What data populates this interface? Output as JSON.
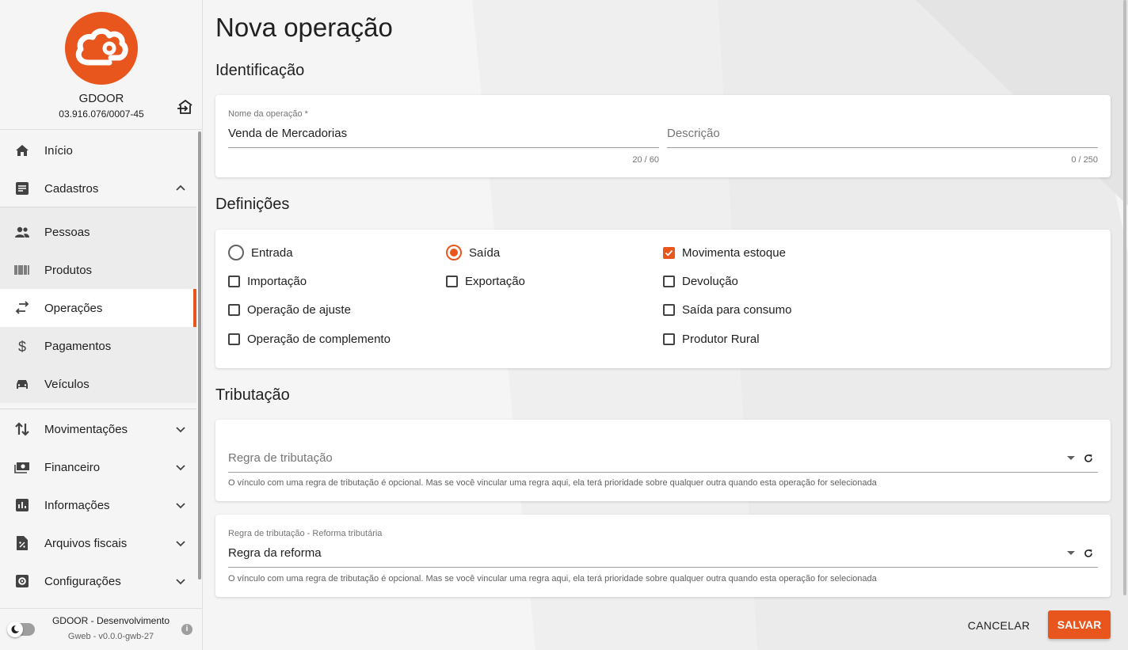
{
  "company": {
    "name": "GDOOR",
    "cnpj": "03.916.076/0007-45",
    "logo_icon": "gdoor-cloud-logo",
    "logout_icon": "logout-icon"
  },
  "nav": {
    "inicio": "Início",
    "cadastros": "Cadastros",
    "pessoas": "Pessoas",
    "produtos": "Produtos",
    "operacoes": "Operações",
    "pagamentos": "Pagamentos",
    "veiculos": "Veículos",
    "movimentacoes": "Movimentações",
    "financeiro": "Financeiro",
    "informacoes": "Informações",
    "arquivos_fiscais": "Arquivos fiscais",
    "configuracoes": "Configurações",
    "active": "Operações"
  },
  "footer": {
    "env_name": "GDOOR - Desenvolvimento",
    "version": "Gweb - v0.0.0-gwb-27",
    "info_icon": "i"
  },
  "page": {
    "title": "Nova operação"
  },
  "identificacao": {
    "title": "Identificação",
    "nome_label": "Nome da operação *",
    "nome_value": "Venda de Mercadorias",
    "nome_counter": "20 / 60",
    "descricao_placeholder": "Descrição",
    "descricao_counter": "0 / 250"
  },
  "definicoes": {
    "title": "Definições",
    "entrada": "Entrada",
    "saida": "Saída",
    "selected_type": "Saída",
    "movimenta_estoque": "Movimenta estoque",
    "importacao": "Importação",
    "exportacao": "Exportação",
    "devolucao": "Devolução",
    "operacao_ajuste": "Operação de ajuste",
    "saida_consumo": "Saída para consumo",
    "operacao_complemento": "Operação de complemento",
    "produtor_rural": "Produtor Rural",
    "checked": [
      "Movimenta estoque"
    ]
  },
  "tributacao": {
    "title": "Tributação",
    "regra_placeholder": "Regra de tributação",
    "regra_hint": "O vínculo com uma regra de tributação é opcional. Mas se você vincular uma regra aqui, ela terá prioridade sobre qualquer outra quando esta operação for selecionada",
    "reforma_label": "Regra de tributação - Reforma tributária",
    "reforma_value": "Regra da reforma",
    "reforma_hint": "O vínculo com uma regra de tributação é opcional. Mas se você vincular uma regra aqui, ela terá prioridade sobre qualquer outra quando esta operação for selecionada"
  },
  "actions": {
    "cancel": "CANCELAR",
    "save": "SALVAR"
  },
  "colors": {
    "accent": "#e8561e",
    "background": "#f5f5f5",
    "card": "#ffffff"
  }
}
